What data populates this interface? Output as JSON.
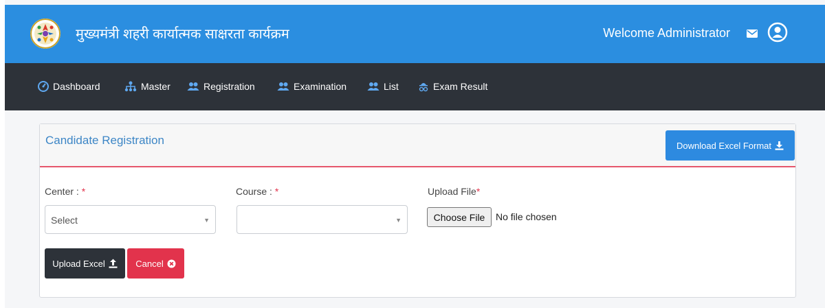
{
  "header": {
    "app_title": "मुख्यमंत्री शहरी कार्यात्मक साक्षरता कार्यक्रम",
    "welcome": "Welcome Administrator",
    "icons": [
      "logo-emblem",
      "mail-icon",
      "user-avatar-icon"
    ]
  },
  "nav": {
    "items": [
      {
        "label": "Dashboard",
        "icon": "dashboard-gauge-icon"
      },
      {
        "label": "Master",
        "icon": "sitemap-icon"
      },
      {
        "label": "Registration",
        "icon": "users-icon"
      },
      {
        "label": "Examination",
        "icon": "users-icon"
      },
      {
        "label": "List",
        "icon": "users-icon"
      },
      {
        "label": "Exam Result",
        "icon": "user-glasses-icon"
      }
    ]
  },
  "card": {
    "title": "Candidate Registration",
    "download_label": "Download Excel Format"
  },
  "form": {
    "center": {
      "label": "Center :",
      "required": "*",
      "value": "Select"
    },
    "course": {
      "label": "Course :",
      "required": "*",
      "value": ""
    },
    "upload": {
      "label": "Upload File",
      "required": "*",
      "button": "Choose File",
      "status": "No file chosen"
    }
  },
  "actions": {
    "upload_label": "Upload Excel",
    "cancel_label": "Cancel"
  },
  "colors": {
    "header_bg": "#2b8ee0",
    "nav_bg": "#2d3239",
    "primary": "#2d8ae0",
    "danger": "#e2334c",
    "accent_line": "#e5566b",
    "title_blue": "#3d86c6"
  }
}
